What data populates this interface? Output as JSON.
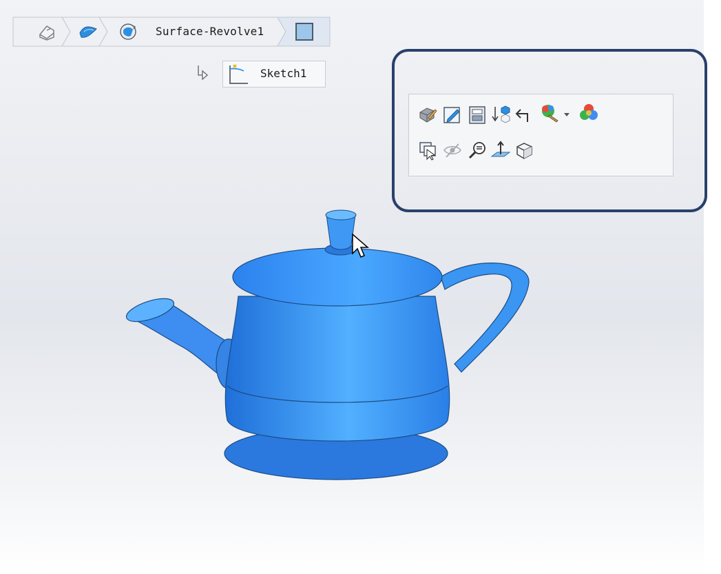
{
  "breadcrumb": {
    "items": [
      {
        "icon": "part-icon"
      },
      {
        "icon": "surface-icon"
      },
      {
        "icon": "revolve-icon",
        "label": "Surface-Revolve1"
      },
      {
        "icon": "face-icon"
      }
    ],
    "child": {
      "icon": "sketch-icon",
      "label": "Sketch1"
    }
  },
  "context_toolbar": {
    "row1": [
      "edit-feature-icon",
      "edit-sketch-icon",
      "feature-properties-icon",
      "rollback-icon",
      "parent-child-icon",
      "appearance-icon",
      "dropdown-arrow-icon",
      "appearances-icon"
    ],
    "row2": [
      "select-other-icon",
      "hide-icon",
      "zoom-to-selection-icon",
      "normal-to-icon",
      "view-orientation-icon"
    ]
  },
  "model": {
    "name": "teapot",
    "color": "#3d8ef0"
  },
  "colors": {
    "highlight": "#29406a",
    "toolbar_bg": "#f5f6f8"
  }
}
